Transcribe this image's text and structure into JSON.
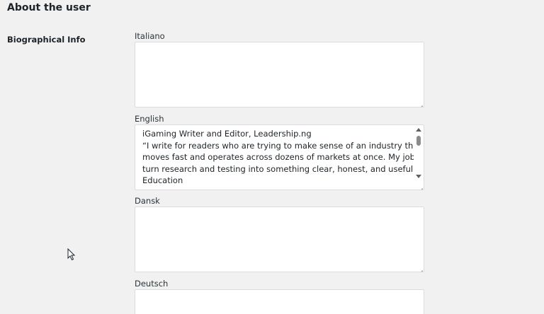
{
  "section": {
    "title": "About the user"
  },
  "bio_row": {
    "label": "Biographical Info"
  },
  "languages": {
    "italiano": {
      "label": "Italiano",
      "value": ""
    },
    "english": {
      "label": "English",
      "lines": [
        "iGaming Writer and Editor, Leadership.ng",
        "“I write for readers who are trying to make sense of an industry that",
        "moves fast and operates across dozens of markets at once. My job is to",
        "turn research and testing into something clear, honest, and useful.\"",
        "Education"
      ]
    },
    "dansk": {
      "label": "Dansk",
      "value": ""
    },
    "deutsch": {
      "label": "Deutsch",
      "value": ""
    }
  },
  "icons": {
    "scroll_up": "triangle-up",
    "scroll_down": "triangle-down",
    "resize_handle": "diagonal-lines",
    "cursor": "arrow-pointer"
  },
  "colors": {
    "background": "#f1f1f1",
    "field_background": "#ffffff",
    "field_border": "#dcdcde",
    "text": "#1d2327"
  }
}
